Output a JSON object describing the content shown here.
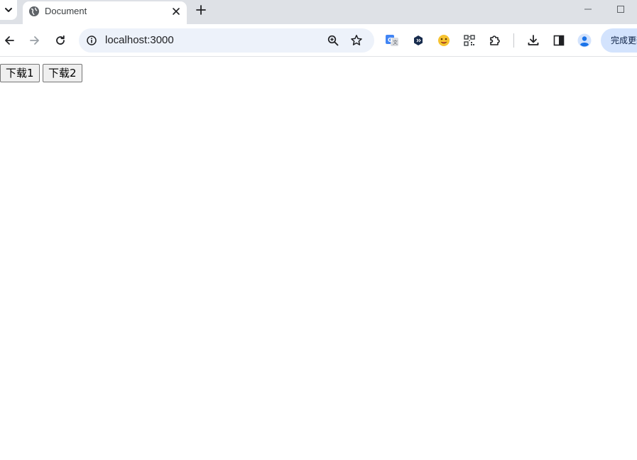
{
  "browser": {
    "tab": {
      "title": "Document"
    },
    "address_bar": {
      "url": "localhost:3000"
    },
    "update_button": {
      "label": "完成更新"
    },
    "extensions": [
      "translate-icon",
      "hexagon-extension-icon",
      "emoji-extension-icon",
      "qr-code-icon",
      "puzzle-piece-icon"
    ]
  },
  "page": {
    "buttons": [
      {
        "label": "下载1"
      },
      {
        "label": "下载2"
      }
    ]
  },
  "colors": {
    "tabstrip_bg": "#dee1e6",
    "omnibox_bg": "#edf2fa",
    "update_pill_bg": "#d3e3fd",
    "button_bg": "#efefef"
  }
}
